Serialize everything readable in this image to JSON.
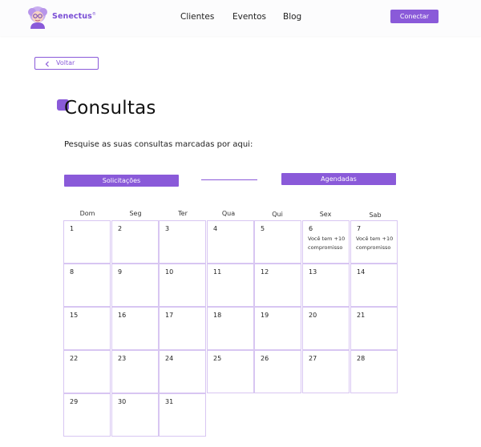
{
  "header": {
    "brand": "Senectus",
    "nav": [
      "Clientes",
      "Eventos",
      "Blog"
    ],
    "connect_label": "Conectar"
  },
  "back_label": "Voltar",
  "page_title": "Consultas",
  "subtitle": "Pesquise as suas consultas marcadas por aqui:",
  "tabs": {
    "requests": "Solicitações",
    "scheduled": "Agendadas"
  },
  "calendar": {
    "weekdays": [
      "Dom",
      "Seg",
      "Ter",
      "Qua",
      "Qui",
      "Sex",
      "Sab"
    ],
    "days": [
      "1",
      "2",
      "3",
      "4",
      "5",
      "6",
      "7",
      "8",
      "9",
      "10",
      "11",
      "12",
      "13",
      "14",
      "15",
      "16",
      "17",
      "18",
      "19",
      "20",
      "21",
      "22",
      "23",
      "24",
      "25",
      "26",
      "27",
      "28",
      "29",
      "30",
      "31"
    ],
    "notes": {
      "6": "Você tem +10 compromisso",
      "7": "Você tem +10 compromisso"
    }
  },
  "colors": {
    "accent": "#8a5ad9",
    "cell_border": "#d8c6f2"
  }
}
